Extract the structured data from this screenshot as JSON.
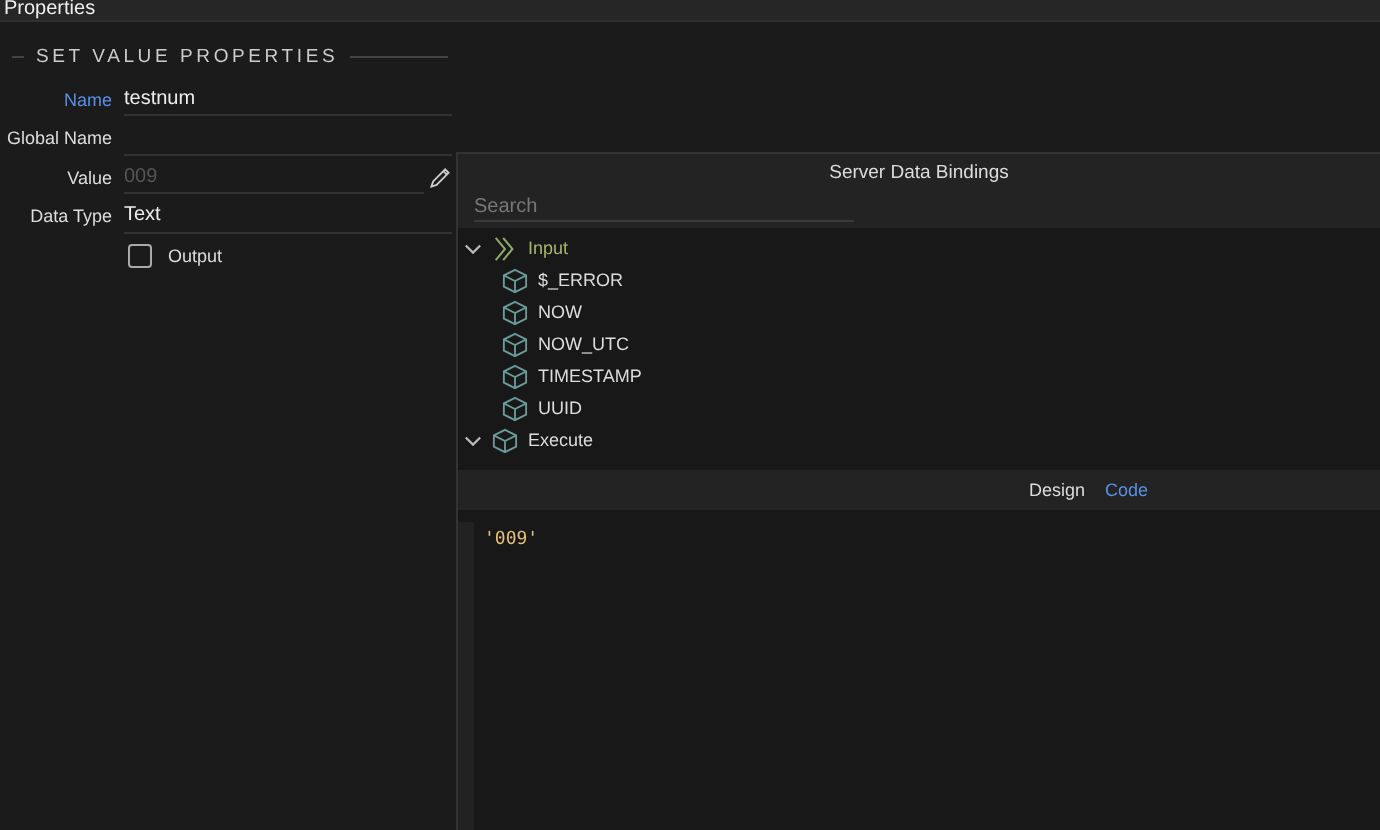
{
  "panel": {
    "title": "Properties",
    "section": "SET VALUE PROPERTIES",
    "fields": [
      {
        "label": "Name",
        "value": "testnum",
        "selected": true,
        "kind": "text"
      },
      {
        "label": "Global Name",
        "selected": false,
        "kind": "text"
      },
      {
        "label": "Value",
        "placeholder": "009",
        "selected": false,
        "kind": "edit"
      },
      {
        "label": "Data Type",
        "value": "Text",
        "selected": false,
        "kind": "text"
      }
    ],
    "output": {
      "label": "Output",
      "checked": false
    }
  },
  "dialog": {
    "title": "Server Data Bindings",
    "search": {
      "placeholder": "Search"
    },
    "tree": [
      {
        "label": "Input",
        "kind": "input",
        "expanded": true,
        "children": [
          {
            "label": "$_ERROR",
            "kind": "cube"
          },
          {
            "label": "NOW",
            "kind": "cube"
          },
          {
            "label": "NOW_UTC",
            "kind": "cube"
          },
          {
            "label": "TIMESTAMP",
            "kind": "cube"
          },
          {
            "label": "UUID",
            "kind": "cube"
          }
        ]
      },
      {
        "label": "Execute",
        "kind": "cube",
        "expanded": true
      }
    ],
    "tabs": [
      {
        "label": "Design",
        "selected": false
      },
      {
        "label": "Code",
        "selected": true
      }
    ],
    "code": "'009'"
  }
}
